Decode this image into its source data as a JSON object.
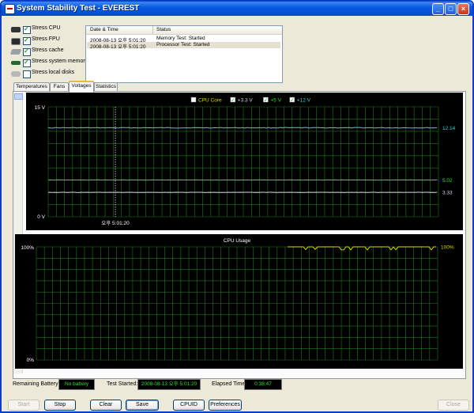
{
  "window": {
    "title": "System Stability Test - EVEREST"
  },
  "titlebar_buttons": [
    "_",
    "□",
    "×"
  ],
  "stress_options": [
    {
      "label": "Stress CPU",
      "checked": true,
      "icon": "cpu-icon"
    },
    {
      "label": "Stress FPU",
      "checked": true,
      "icon": "fpu-icon"
    },
    {
      "label": "Stress cache",
      "checked": true,
      "icon": "cache-icon"
    },
    {
      "label": "Stress system memory",
      "checked": true,
      "icon": "memory-icon"
    },
    {
      "label": "Stress local disks",
      "checked": false,
      "icon": "disk-icon"
    }
  ],
  "log": {
    "headers": {
      "datetime": "Date & Time",
      "status": "Status"
    },
    "rows": [
      {
        "datetime": "2008-08-13 오후 5:01:20",
        "status": "Memory Test: Started"
      },
      {
        "datetime": "2008-08-13 오후 5:01:20",
        "status": "Processor Test: Started"
      }
    ]
  },
  "tabs": [
    "Temperatures",
    "Fans",
    "Voltages",
    "Statistics"
  ],
  "active_tab": "Voltages",
  "chart_data": [
    {
      "type": "line",
      "title": "",
      "legend": [
        {
          "name": "CPU Core",
          "checked": false,
          "color": "#d8d800"
        },
        {
          "name": "+3.3 V",
          "checked": true,
          "color": "#cfd8e8"
        },
        {
          "name": "+5 V",
          "checked": true,
          "color": "#30e030"
        },
        {
          "name": "+12 V",
          "checked": true,
          "color": "#30d8d8"
        }
      ],
      "y_top_label": "15 V",
      "y_bottom_label": "0 V",
      "ylim": [
        0,
        15
      ],
      "x_marker_label": "오후 5:01:20",
      "series": [
        {
          "name": "+12 V",
          "value": 12.14,
          "label": "12.14",
          "color": "#30d8d8"
        },
        {
          "name": "+5 V",
          "value": 5.02,
          "label": "5.02",
          "color": "#30e030"
        },
        {
          "name": "+3.3 V",
          "value": 3.33,
          "label": "3.33",
          "color": "#cfd8e8"
        }
      ],
      "grid": true
    },
    {
      "type": "line",
      "title": "CPU Usage",
      "y_top_label": "100%",
      "y_bottom_label": "0%",
      "ylim": [
        0,
        100
      ],
      "series": [
        {
          "name": "CPU Usage",
          "value": 100,
          "label": "100%",
          "color": "#d8d800"
        }
      ],
      "grid": true
    }
  ],
  "status": {
    "battery_label": "Remaining Battery:",
    "battery_value": "No battery",
    "started_label": "Test Started:",
    "started_value": "2008-08-13 오후 5:01:20",
    "elapsed_label": "Elapsed Time:",
    "elapsed_value": "0:38:47"
  },
  "buttons": {
    "start": "Start",
    "stop": "Stop",
    "clear": "Clear",
    "save": "Save",
    "cpuid": "CPUID",
    "preferences": "Preferences",
    "close": "Close"
  }
}
